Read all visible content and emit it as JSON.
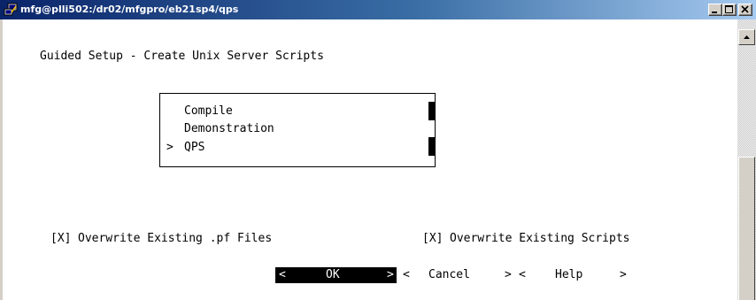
{
  "window": {
    "title": "mfg@plli502:/dr02/mfgpro/eb21sp4/qps"
  },
  "screen": {
    "heading": "Guided Setup - Create Unix Server Scripts",
    "list": {
      "items": [
        {
          "label": "Compile",
          "selected": false
        },
        {
          "label": "Demonstration",
          "selected": false
        },
        {
          "label": "QPS",
          "selected": true
        }
      ],
      "selection_marker": ">"
    },
    "options": [
      {
        "checkbox": "[X]",
        "label": "Overwrite Existing .pf Files"
      },
      {
        "checkbox": "[X]",
        "label": "Overwrite Existing Scripts"
      }
    ],
    "buttons": {
      "ok": {
        "open": "<",
        "label": "OK",
        "close": ">"
      },
      "cancel": {
        "open": "<",
        "label": "Cancel",
        "close": ">"
      },
      "help": {
        "open": "<",
        "label": "Help",
        "close": ">"
      }
    }
  },
  "colors": {
    "titlebar_start": "#0a246a",
    "titlebar_end": "#a6caf0",
    "terminal_bg": "#ffffff",
    "terminal_text": "#000000"
  },
  "icons": {
    "app": "putty-terminal-icon",
    "minimize": "minimize-icon",
    "maximize": "maximize-icon",
    "close": "close-icon",
    "scroll_up": "arrow-up-icon"
  }
}
